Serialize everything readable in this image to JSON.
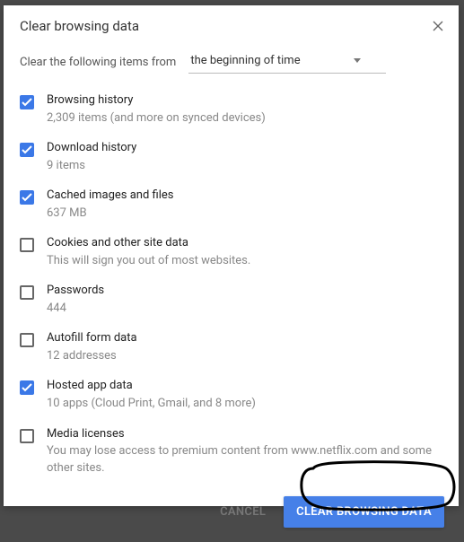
{
  "dialog": {
    "title": "Clear browsing data",
    "subtitle": "Clear the following items from",
    "time_range": "the beginning of time"
  },
  "options": [
    {
      "label": "Browsing history",
      "sub": "2,309 items (and more on synced devices)",
      "checked": true
    },
    {
      "label": "Download history",
      "sub": "9 items",
      "checked": true
    },
    {
      "label": "Cached images and files",
      "sub": "637 MB",
      "checked": true
    },
    {
      "label": "Cookies and other site data",
      "sub": "This will sign you out of most websites.",
      "checked": false
    },
    {
      "label": "Passwords",
      "sub": "444",
      "checked": false
    },
    {
      "label": "Autofill form data",
      "sub": "12 addresses",
      "checked": false
    },
    {
      "label": "Hosted app data",
      "sub": "10 apps (Cloud Print, Gmail, and 8 more)",
      "checked": true
    },
    {
      "label": "Media licenses",
      "sub": "You may lose access to premium content from www.netflix.com and some other sites.",
      "checked": false
    }
  ],
  "footer": {
    "cancel": "CANCEL",
    "confirm": "CLEAR BROWSING DATA"
  }
}
